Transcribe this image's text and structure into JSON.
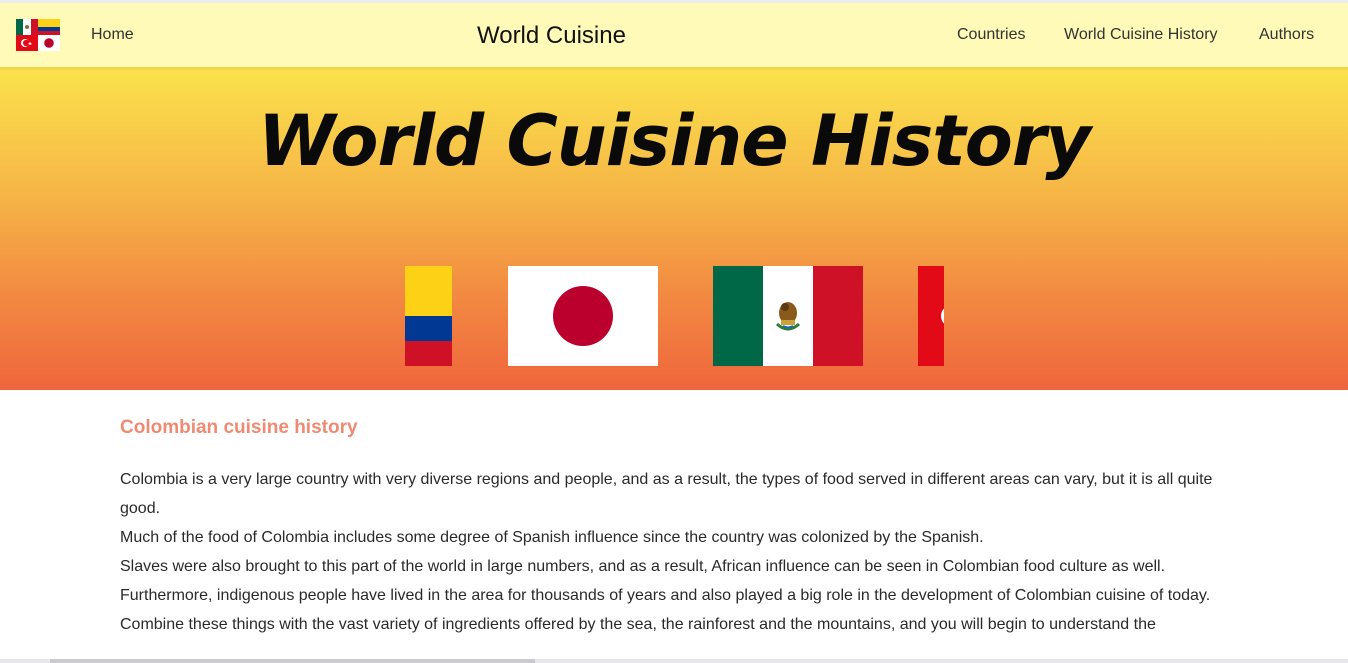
{
  "nav": {
    "logo_icon": "world-flags-logo-icon",
    "home_label": "Home",
    "brand_label": "World Cuisine",
    "links": [
      {
        "label": "Countries"
      },
      {
        "label": "World Cuisine History"
      },
      {
        "label": "Authors"
      }
    ]
  },
  "hero": {
    "title": "World Cuisine History",
    "flags": [
      {
        "name": "colombia-flag-icon"
      },
      {
        "name": "japan-flag-icon"
      },
      {
        "name": "mexico-flag-icon"
      },
      {
        "name": "turkey-flag-icon"
      }
    ],
    "colors": {
      "gradient_top": "#fbe24c",
      "gradient_bottom": "#ef653c"
    }
  },
  "article": {
    "heading": "Colombian cuisine history",
    "heading_color": "#f08a72",
    "paragraphs": [
      "Colombia is a very large country with very diverse regions and people, and as a result, the types of food served in different areas can vary, but it is all quite good.",
      "Much of the food of Colombia includes some degree of Spanish influence since the country was colonized by the Spanish.",
      "Slaves were also brought to this part of the world in large numbers, and as a result, African influence can be seen in Colombian food culture as well.",
      "Furthermore, indigenous people have lived in the area for thousands of years and also played a big role in the development of Colombian cuisine of today.",
      "Combine these things with the vast variety of ingredients offered by the sea, the rainforest and the mountains, and you will begin to understand the"
    ]
  },
  "colors": {
    "navbar_bg": "#fffab8",
    "navbar_border": "#f3d44a"
  }
}
